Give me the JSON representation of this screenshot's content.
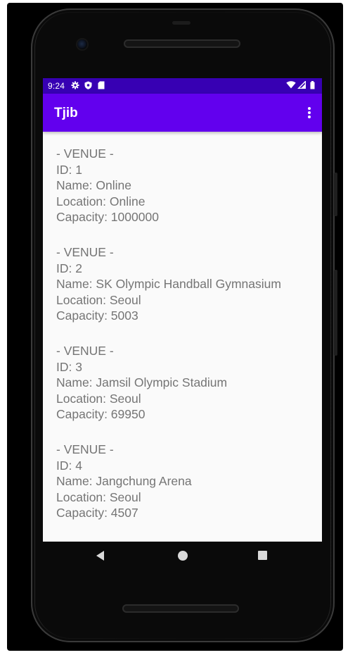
{
  "status_bar": {
    "time": "9:24",
    "icons": [
      "settings-gear-icon",
      "shield-icon",
      "sd-card-icon",
      "wifi-icon",
      "signal-icon",
      "battery-icon"
    ]
  },
  "app_bar": {
    "title": "Tjib",
    "menu_icon": "more-vert-icon"
  },
  "venues": [
    {
      "header": "- VENUE -",
      "id_line": "ID: 1",
      "name_line": "Name: Online",
      "location_line": "Location: Online",
      "capacity_line": "Capacity: 1000000"
    },
    {
      "header": "- VENUE -",
      "id_line": "ID: 2",
      "name_line": "Name: SK Olympic Handball Gymnasium",
      "location_line": "Location: Seoul",
      "capacity_line": "Capacity: 5003"
    },
    {
      "header": "- VENUE -",
      "id_line": "ID: 3",
      "name_line": "Name: Jamsil Olympic Stadium",
      "location_line": "Location: Seoul",
      "capacity_line": "Capacity: 69950"
    },
    {
      "header": "- VENUE -",
      "id_line": "ID: 4",
      "name_line": "Name: Jangchung Arena",
      "location_line": "Location: Seoul",
      "capacity_line": "Capacity: 4507"
    }
  ],
  "nav_bar": {
    "back_icon": "back-triangle-icon",
    "home_icon": "home-circle-icon",
    "recents_icon": "recents-square-icon"
  },
  "colors": {
    "status_bar": "#3700b3",
    "app_bar": "#6200ee",
    "screen_background": "#fafafa",
    "body_text": "#757575"
  }
}
